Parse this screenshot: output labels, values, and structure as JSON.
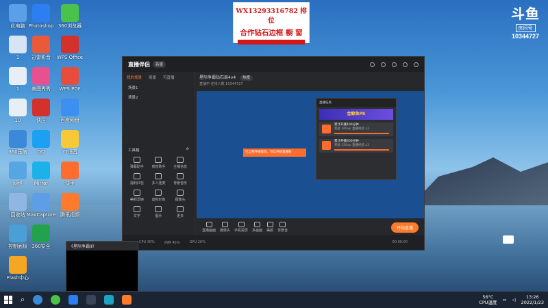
{
  "banner": {
    "line1": "WX13293316782 排位",
    "line2": "合作钻石边框  橱 窗"
  },
  "douyu": {
    "logo": "斗鱼",
    "sub": "房间号",
    "room": "10344727"
  },
  "desktop_icons": [
    {
      "label": "此电脑",
      "color": "#5aa0e8"
    },
    {
      "label": "1",
      "color": "#d7e4f5"
    },
    {
      "label": "1",
      "color": "#e8eef6"
    },
    {
      "label": "10",
      "color": "#e8eef6"
    },
    {
      "label": "360压缩",
      "color": "#3b8ad9"
    },
    {
      "label": "网络",
      "color": "#58a5e3"
    },
    {
      "label": "回收站",
      "color": "#8fb7e1"
    },
    {
      "label": "控制面板",
      "color": "#4aa0d6"
    },
    {
      "label": "Flash中心",
      "color": "#f5a623"
    },
    {
      "label": "Photoshop",
      "color": "#2d7ef0"
    },
    {
      "label": "迅雷影音",
      "color": "#e95a3a"
    },
    {
      "label": "美图秀秀",
      "color": "#e85090"
    },
    {
      "label": "快压",
      "color": "#d4302c"
    },
    {
      "label": "QQ",
      "color": "#1da0f2"
    },
    {
      "label": "Mirror",
      "color": "#1db1e9"
    },
    {
      "label": "MaxCapture",
      "color": "#5e9ee6"
    },
    {
      "label": "360安全",
      "color": "#23a24d"
    },
    {
      "label": "360浏览器",
      "color": "#4bc34b"
    },
    {
      "label": "WPS Office",
      "color": "#d4302c"
    },
    {
      "label": "WPS PDF",
      "color": "#e84c3d"
    },
    {
      "label": "百度网盘",
      "color": "#3e90f0"
    },
    {
      "label": "YY语音",
      "color": "#f7c936"
    },
    {
      "label": "快手",
      "color": "#ff6d2e"
    },
    {
      "label": "腾讯视频",
      "color": "#ff7a2a"
    }
  ],
  "app": {
    "logo": "直播伴侣",
    "badge": "新版",
    "tabs": [
      "我的场景",
      "场景",
      "可直播"
    ],
    "scenes": [
      "场景1",
      "场景2"
    ],
    "tools_title": "工具箱",
    "tools": [
      "弹幕助手",
      "房管助手",
      "主播信息",
      "福利红包",
      "多人连麦",
      "背景音乐",
      "美颜滤镜",
      "虚拟形象",
      "摄像头",
      "文字",
      "图片",
      "更多"
    ],
    "room_title": "星际争霸钻石局4v4",
    "room_badge": "热度",
    "room_sub": "直播中  在线人数 10344727",
    "task_header": "直播任务",
    "pk_text": "金鲸鱼PK",
    "tasks": [
      {
        "title": "累计开播100分钟",
        "desc": "奖励 100xp 直播经验 x1"
      },
      {
        "title": "累计开播300分钟",
        "desc": "奖励 150xp 直播经验 x1"
      }
    ],
    "tooltip": "已全部开播成功，可以开始直播啦",
    "bottom": [
      "直播画面",
      "摄像头",
      "手机投屏",
      "多画面",
      "美颜",
      "背景音"
    ],
    "start": "开始直播",
    "status": [
      "CPU 30%",
      "内存 45%",
      "GPU 20%",
      "00:00:00"
    ]
  },
  "small_window": {
    "title": "《星际争霸II》"
  },
  "taskbar": {
    "weather": "56°C",
    "weather_sub": "CPU温度",
    "time": "13:26",
    "date": "2022/1/23"
  }
}
